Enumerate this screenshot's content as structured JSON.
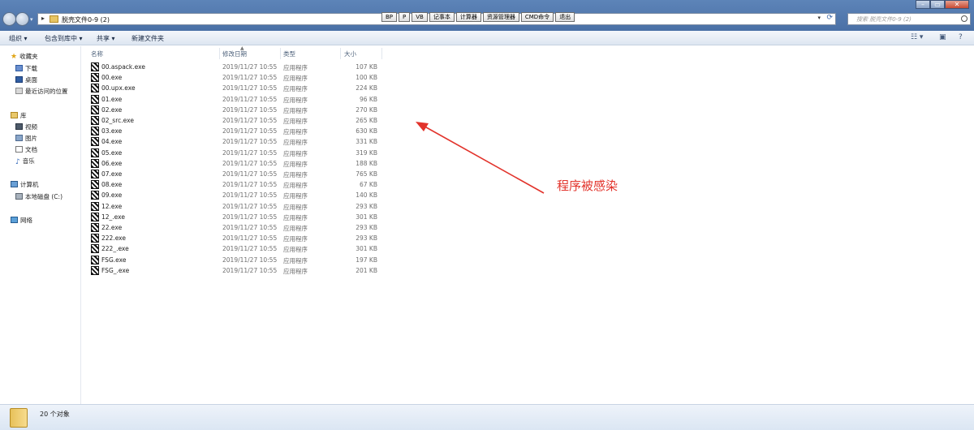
{
  "address": {
    "path": "脱壳文件0-9 (2)"
  },
  "quick_buttons": [
    "BP",
    "P",
    "VB",
    "记事本",
    "计算器",
    "资源管理器",
    "CMD命令",
    "退出"
  ],
  "search": {
    "placeholder": "搜索 脱壳文件0-9 (2)"
  },
  "toolbar": {
    "organize": "组织 ▾",
    "include": "包含到库中 ▾",
    "share": "共享 ▾",
    "new_folder": "新建文件夹"
  },
  "nav": {
    "favorites": "收藏夹",
    "downloads": "下载",
    "desktop": "桌面",
    "recent": "最近访问的位置",
    "libraries": "库",
    "videos": "视频",
    "pictures": "图片",
    "documents": "文档",
    "music": "音乐",
    "computer": "计算机",
    "local_disk": "本地磁盘 (C:)",
    "network": "网络"
  },
  "columns": {
    "name": "名称",
    "date": "修改日期",
    "type": "类型",
    "size": "大小"
  },
  "files": [
    {
      "name": "00.aspack.exe",
      "date": "2019/11/27 10:55",
      "type": "应用程序",
      "size": "107 KB"
    },
    {
      "name": "00.exe",
      "date": "2019/11/27 10:55",
      "type": "应用程序",
      "size": "100 KB"
    },
    {
      "name": "00.upx.exe",
      "date": "2019/11/27 10:55",
      "type": "应用程序",
      "size": "224 KB"
    },
    {
      "name": "01.exe",
      "date": "2019/11/27 10:55",
      "type": "应用程序",
      "size": "96 KB"
    },
    {
      "name": "02.exe",
      "date": "2019/11/27 10:55",
      "type": "应用程序",
      "size": "270 KB"
    },
    {
      "name": "02_src.exe",
      "date": "2019/11/27 10:55",
      "type": "应用程序",
      "size": "265 KB"
    },
    {
      "name": "03.exe",
      "date": "2019/11/27 10:55",
      "type": "应用程序",
      "size": "630 KB"
    },
    {
      "name": "04.exe",
      "date": "2019/11/27 10:55",
      "type": "应用程序",
      "size": "331 KB"
    },
    {
      "name": "05.exe",
      "date": "2019/11/27 10:55",
      "type": "应用程序",
      "size": "319 KB"
    },
    {
      "name": "06.exe",
      "date": "2019/11/27 10:55",
      "type": "应用程序",
      "size": "188 KB"
    },
    {
      "name": "07.exe",
      "date": "2019/11/27 10:55",
      "type": "应用程序",
      "size": "765 KB"
    },
    {
      "name": "08.exe",
      "date": "2019/11/27 10:55",
      "type": "应用程序",
      "size": "67 KB"
    },
    {
      "name": "09.exe",
      "date": "2019/11/27 10:55",
      "type": "应用程序",
      "size": "140 KB"
    },
    {
      "name": "12.exe",
      "date": "2019/11/27 10:55",
      "type": "应用程序",
      "size": "293 KB"
    },
    {
      "name": "12_.exe",
      "date": "2019/11/27 10:55",
      "type": "应用程序",
      "size": "301 KB"
    },
    {
      "name": "22.exe",
      "date": "2019/11/27 10:55",
      "type": "应用程序",
      "size": "293 KB"
    },
    {
      "name": "222.exe",
      "date": "2019/11/27 10:55",
      "type": "应用程序",
      "size": "293 KB"
    },
    {
      "name": "222_.exe",
      "date": "2019/11/27 10:55",
      "type": "应用程序",
      "size": "301 KB"
    },
    {
      "name": "FSG.exe",
      "date": "2019/11/27 10:55",
      "type": "应用程序",
      "size": "197 KB"
    },
    {
      "name": "FSG_.exe",
      "date": "2019/11/27 10:55",
      "type": "应用程序",
      "size": "201 KB"
    }
  ],
  "annotation": {
    "text": "程序被感染",
    "color": "#e2332b"
  },
  "status": {
    "count": "20 个对象"
  }
}
